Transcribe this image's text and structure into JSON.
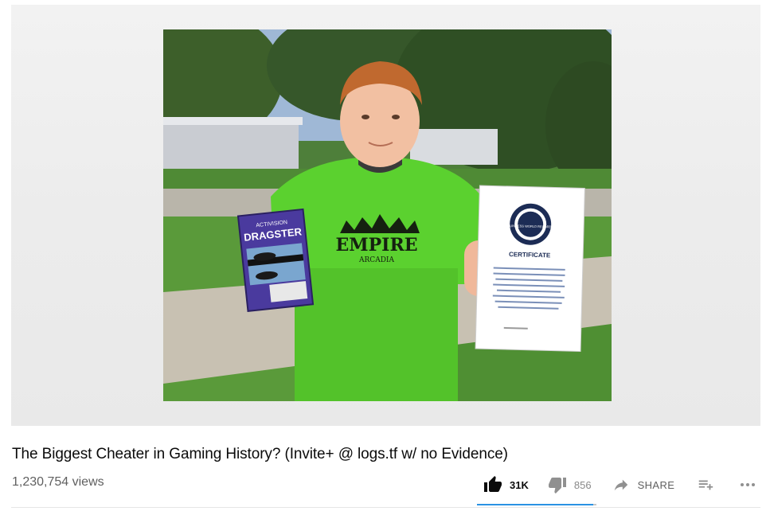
{
  "video": {
    "title": "The Biggest Cheater in Gaming History? (Invite+ @ logs.tf w/ no Evidence)",
    "views": "1,230,754 views",
    "thumbnail_text": {
      "box_brand": "ACTIVISION",
      "box_title": "DRAGSTER",
      "shirt_text": "EMPIRE",
      "shirt_subtext": "ARCADIA",
      "seal_text": "GUINNESS WORLD RECORDS",
      "certificate_label": "CERTIFICATE"
    }
  },
  "actions": {
    "like_count": "31K",
    "dislike_count": "856",
    "share_label": "SHARE",
    "like_ratio": 0.973
  },
  "colors": {
    "accent": "#2b92e3",
    "text_primary": "#0b0b0b",
    "text_secondary": "#606060"
  },
  "icons": {
    "like": "thumbs-up-icon",
    "dislike": "thumbs-down-icon",
    "share": "share-arrow-icon",
    "save": "playlist-add-icon",
    "more": "more-horiz-icon"
  }
}
